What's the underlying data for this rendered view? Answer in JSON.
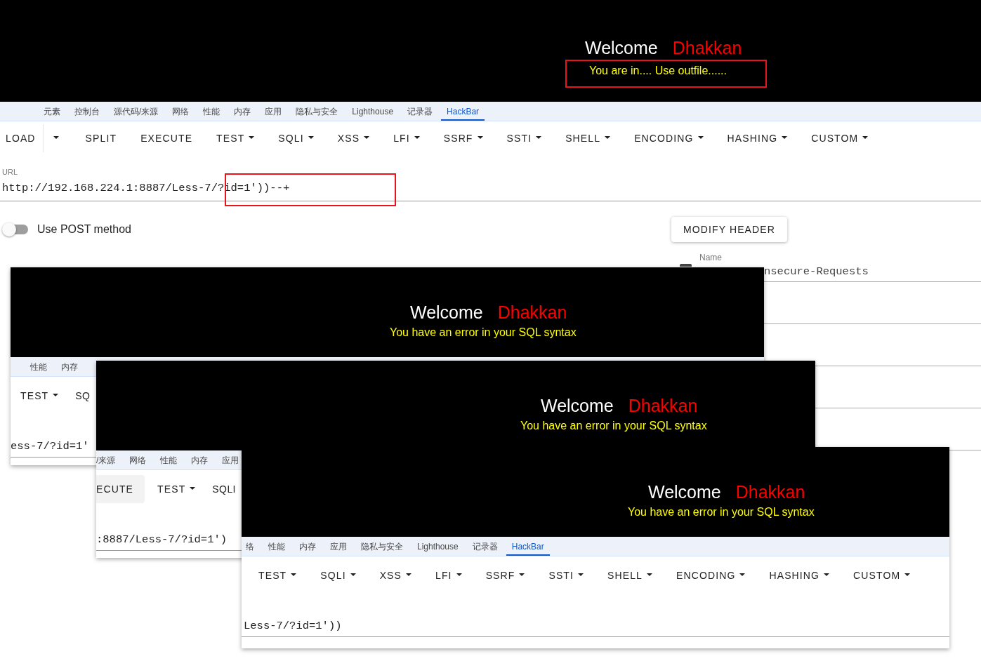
{
  "banner": {
    "welcome": "Welcome",
    "name": "Dhakkan",
    "message": "You are in.... Use outfile......",
    "highlighted": true
  },
  "devtools_tabs": [
    {
      "label": "元素",
      "selected": false
    },
    {
      "label": "控制台",
      "selected": false
    },
    {
      "label": "源代码/来源",
      "selected": false
    },
    {
      "label": "网络",
      "selected": false
    },
    {
      "label": "性能",
      "selected": false
    },
    {
      "label": "内存",
      "selected": false
    },
    {
      "label": "应用",
      "selected": false
    },
    {
      "label": "隐私与安全",
      "selected": false
    },
    {
      "label": "Lighthouse",
      "selected": false
    },
    {
      "label": "记录器",
      "selected": false
    },
    {
      "label": "HackBar",
      "selected": true
    }
  ],
  "toolbar": [
    {
      "label": "LOAD",
      "kind": "split",
      "hovered": false
    },
    {
      "label": "SPLIT",
      "kind": "button",
      "hovered": false
    },
    {
      "label": "EXECUTE",
      "kind": "button",
      "hovered": false
    },
    {
      "label": "TEST",
      "kind": "menu",
      "hovered": false
    },
    {
      "label": "SQLI",
      "kind": "menu",
      "hovered": false
    },
    {
      "label": "XSS",
      "kind": "menu",
      "hovered": false
    },
    {
      "label": "LFI",
      "kind": "menu",
      "hovered": false
    },
    {
      "label": "SSRF",
      "kind": "menu",
      "hovered": false
    },
    {
      "label": "SSTI",
      "kind": "menu",
      "hovered": false
    },
    {
      "label": "SHELL",
      "kind": "menu",
      "hovered": false
    },
    {
      "label": "ENCODING",
      "kind": "menu",
      "hovered": false
    },
    {
      "label": "HASHING",
      "kind": "menu",
      "hovered": false
    },
    {
      "label": "CUSTOM",
      "kind": "menu",
      "hovered": false
    }
  ],
  "url": {
    "label": "URL",
    "value": "http://192.168.224.1:8887/Less-7/?id=1'))--+",
    "highlighted": true
  },
  "post_toggle": {
    "label": "Use POST method",
    "on": false
  },
  "modify_header_button": "MODIFY HEADER",
  "header": {
    "label": "Name",
    "value": "nsecure-Requests",
    "checked": true
  },
  "screenshots": [
    {
      "banner": {
        "welcome": "Welcome",
        "name": "Dhakkan",
        "message": "You have an error in your SQL syntax"
      },
      "tabs": [
        {
          "label": "性能",
          "selected": false
        },
        {
          "label": "内存",
          "selected": false
        }
      ],
      "toolbar": [
        {
          "label": "TEST",
          "kind": "menu",
          "hovered": false
        },
        {
          "label": "SQ",
          "kind": "cut",
          "hovered": false
        }
      ],
      "url": "ess-7/?id=1'"
    },
    {
      "banner": {
        "welcome": "Welcome",
        "name": "Dhakkan",
        "message": "You have an error in your SQL syntax"
      },
      "tabs": [
        {
          "label": "/来源",
          "selected": false
        },
        {
          "label": "网络",
          "selected": false
        },
        {
          "label": "性能",
          "selected": false
        },
        {
          "label": "内存",
          "selected": false
        },
        {
          "label": "应用",
          "selected": false
        }
      ],
      "toolbar": [
        {
          "label": "ECUTE",
          "kind": "button",
          "hovered": true
        },
        {
          "label": "TEST",
          "kind": "menu",
          "hovered": false
        },
        {
          "label": "SQLI",
          "kind": "cut",
          "hovered": false
        }
      ],
      "url": ":8887/Less-7/?id=1')"
    },
    {
      "banner": {
        "welcome": "Welcome",
        "name": "Dhakkan",
        "message": "You have an error in your SQL syntax"
      },
      "tabs": [
        {
          "label": "络",
          "selected": false
        },
        {
          "label": "性能",
          "selected": false
        },
        {
          "label": "内存",
          "selected": false
        },
        {
          "label": "应用",
          "selected": false
        },
        {
          "label": "隐私与安全",
          "selected": false
        },
        {
          "label": "Lighthouse",
          "selected": false
        },
        {
          "label": "记录器",
          "selected": false
        },
        {
          "label": "HackBar",
          "selected": true
        }
      ],
      "toolbar": [
        {
          "label": "TEST",
          "kind": "menu",
          "hovered": false
        },
        {
          "label": "SQLI",
          "kind": "menu",
          "hovered": false
        },
        {
          "label": "XSS",
          "kind": "menu",
          "hovered": false
        },
        {
          "label": "LFI",
          "kind": "menu",
          "hovered": false
        },
        {
          "label": "SSRF",
          "kind": "menu",
          "hovered": false
        },
        {
          "label": "SSTI",
          "kind": "menu",
          "hovered": false
        },
        {
          "label": "SHELL",
          "kind": "menu",
          "hovered": false
        },
        {
          "label": "ENCODING",
          "kind": "menu",
          "hovered": false
        },
        {
          "label": "HASHING",
          "kind": "menu",
          "hovered": false
        },
        {
          "label": "CUSTOM",
          "kind": "menu",
          "hovered": false
        }
      ],
      "url": "Less-7/?id=1'))"
    }
  ]
}
